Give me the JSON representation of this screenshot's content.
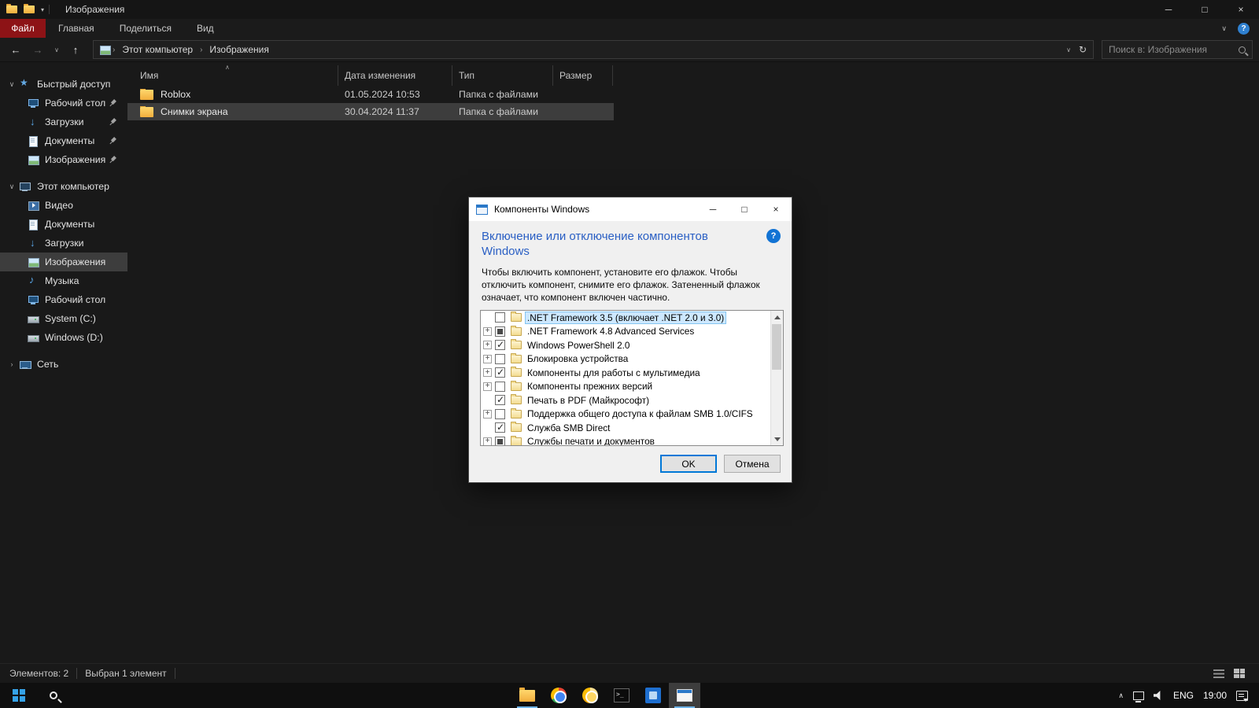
{
  "glyphs": {
    "minimize": "─",
    "maximize": "□",
    "close": "×",
    "back": "←",
    "forward": "→",
    "up": "↑",
    "refresh": "↻",
    "chevron_down": "∨",
    "chevron_right": "›",
    "dropdown": "▾",
    "help": "?",
    "plus": "+",
    "caret_up": "∧"
  },
  "titlebar": {
    "title": "Изображения"
  },
  "ribbon": {
    "tabs": [
      {
        "label": "Файл",
        "active": true
      },
      {
        "label": "Главная",
        "active": false
      },
      {
        "label": "Поделиться",
        "active": false
      },
      {
        "label": "Вид",
        "active": false
      }
    ]
  },
  "addressbar": {
    "breadcrumb": [
      "Этот компьютер",
      "Изображения"
    ],
    "search_placeholder": "Поиск в: Изображения"
  },
  "sidebar": {
    "quick_access": {
      "label": "Быстрый доступ",
      "icon": "star-icon",
      "items": [
        {
          "label": "Рабочий стол",
          "icon": "desktop-icon",
          "pinned": true
        },
        {
          "label": "Загрузки",
          "icon": "downloads-icon",
          "pinned": true
        },
        {
          "label": "Документы",
          "icon": "documents-icon",
          "pinned": true
        },
        {
          "label": "Изображения",
          "icon": "pictures-icon",
          "pinned": true
        }
      ]
    },
    "this_pc": {
      "label": "Этот компьютер",
      "icon": "pc-icon",
      "items": [
        {
          "label": "Видео",
          "icon": "video-icon",
          "selected": false
        },
        {
          "label": "Документы",
          "icon": "documents-icon",
          "selected": false
        },
        {
          "label": "Загрузки",
          "icon": "downloads-icon",
          "selected": false
        },
        {
          "label": "Изображения",
          "icon": "pictures-icon",
          "selected": true
        },
        {
          "label": "Музыка",
          "icon": "music-icon",
          "selected": false
        },
        {
          "label": "Рабочий стол",
          "icon": "desktop-icon",
          "selected": false
        },
        {
          "label": "System (C:)",
          "icon": "drive-icon",
          "selected": false
        },
        {
          "label": "Windows (D:)",
          "icon": "drive-icon",
          "selected": false
        }
      ]
    },
    "network": {
      "label": "Сеть",
      "icon": "network-icon"
    }
  },
  "filelist": {
    "columns": [
      "Имя",
      "Дата изменения",
      "Тип",
      "Размер"
    ],
    "rows": [
      {
        "name": "Roblox",
        "date": "01.05.2024 10:53",
        "type": "Папка с файлами",
        "size": "",
        "selected": false
      },
      {
        "name": "Снимки экрана",
        "date": "30.04.2024 11:37",
        "type": "Папка с файлами",
        "size": "",
        "selected": true
      }
    ]
  },
  "dialog": {
    "title": "Компоненты Windows",
    "heading": "Включение или отключение компонентов Windows",
    "description": "Чтобы включить компонент, установите его флажок. Чтобы отключить компонент, снимите его флажок. Затененный флажок означает, что компонент включен частично.",
    "tree": [
      {
        "label": ".NET Framework 3.5 (включает .NET 2.0 и 3.0)",
        "check": "unchecked",
        "expander": false,
        "selected": true
      },
      {
        "label": ".NET Framework 4.8 Advanced Services",
        "check": "partial",
        "expander": true,
        "selected": false
      },
      {
        "label": "Windows PowerShell 2.0",
        "check": "checked",
        "expander": true,
        "selected": false
      },
      {
        "label": "Блокировка устройства",
        "check": "unchecked",
        "expander": true,
        "selected": false
      },
      {
        "label": "Компоненты для работы с мультимедиа",
        "check": "checked",
        "expander": true,
        "selected": false
      },
      {
        "label": "Компоненты прежних версий",
        "check": "unchecked",
        "expander": true,
        "selected": false
      },
      {
        "label": "Печать в PDF (Майкрософт)",
        "check": "checked",
        "expander": false,
        "selected": false
      },
      {
        "label": "Поддержка общего доступа к файлам SMB 1.0/CIFS",
        "check": "unchecked",
        "expander": true,
        "selected": false
      },
      {
        "label": "Служба SMB Direct",
        "check": "checked",
        "expander": false,
        "selected": false
      },
      {
        "label": "Службы печати и документов",
        "check": "partial",
        "expander": true,
        "selected": false
      }
    ],
    "ok_label": "OK",
    "cancel_label": "Отмена"
  },
  "statusbar": {
    "items_text": "Элементов: 2",
    "selected_text": "Выбран 1 элемент"
  },
  "taskbar": {
    "icons": [
      {
        "name": "explorer",
        "open": true,
        "active": false
      },
      {
        "name": "chrome",
        "open": false,
        "active": false
      },
      {
        "name": "chrome-canary",
        "open": false,
        "active": false
      },
      {
        "name": "terminal",
        "open": false,
        "active": false
      },
      {
        "name": "blue-app",
        "open": false,
        "active": false
      },
      {
        "name": "windows-features",
        "open": true,
        "active": true
      }
    ],
    "tray": {
      "language": "ENG",
      "time": "19:00"
    }
  },
  "colors": {
    "accent": "#0078d7",
    "file_tab_red": "#8d1316",
    "heading_blue": "#2a5fc4",
    "selection_light_blue": "#cde8ff",
    "dark_selection_gray": "#3d3d3d"
  }
}
